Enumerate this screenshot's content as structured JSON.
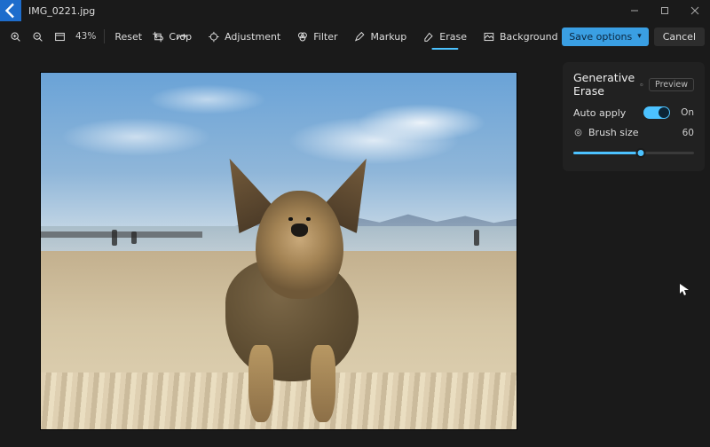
{
  "window": {
    "filename": "IMG_0221.jpg"
  },
  "toolbar": {
    "zoom_percent": "43%",
    "reset": "Reset",
    "save_options": "Save options",
    "cancel": "Cancel"
  },
  "tools": {
    "crop": "Crop",
    "adjustment": "Adjustment",
    "filter": "Filter",
    "markup": "Markup",
    "erase": "Erase",
    "background": "Background",
    "active": "erase"
  },
  "panel": {
    "title": "Generative Erase",
    "preview_badge": "Preview",
    "auto_apply_label": "Auto apply",
    "auto_apply_state": "On",
    "brush_label": "Brush size",
    "brush_value": "60"
  }
}
